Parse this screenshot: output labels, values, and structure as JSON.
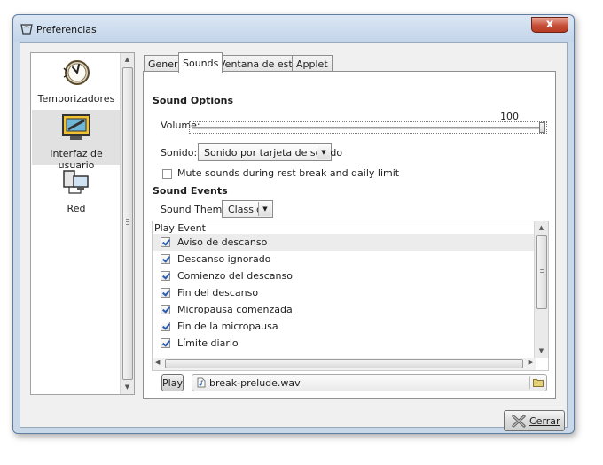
{
  "window": {
    "title": "Preferencias",
    "close_glyph": "x"
  },
  "sidebar": {
    "items": [
      {
        "label": "Temporizadores",
        "icon": "stopwatch-icon"
      },
      {
        "label": "Interfaz de usuario",
        "icon": "monitor-paint-icon"
      },
      {
        "label": "Red",
        "icon": "network-computers-icon"
      }
    ],
    "selected_index": 1
  },
  "tabs": [
    {
      "label": "General"
    },
    {
      "label": "Sounds",
      "active": true
    },
    {
      "label": "Ventana de estado"
    },
    {
      "label": "Applet"
    }
  ],
  "sound_options": {
    "heading": "Sound Options",
    "volume_label": "Volume:",
    "volume_value": "100",
    "volume_level": 100,
    "sonido_label": "Sonido:",
    "sonido_value": "Sonido por tarjeta de sonido",
    "mute_label": "Mute sounds during rest break and daily limit",
    "mute_checked": false
  },
  "sound_events": {
    "heading": "Sound Events",
    "theme_label": "Sound Theme:",
    "theme_value": "Classic",
    "column_header": "Play Event",
    "events": [
      {
        "label": "Aviso de descanso",
        "checked": true
      },
      {
        "label": "Descanso ignorado",
        "checked": true
      },
      {
        "label": "Comienzo del descanso",
        "checked": true
      },
      {
        "label": "Fin del descanso",
        "checked": true
      },
      {
        "label": "Micropausa comenzada",
        "checked": true
      },
      {
        "label": "Fin de la micropausa",
        "checked": true
      },
      {
        "label": "Límite diario",
        "checked": true
      }
    ],
    "play_label": "Play",
    "file_name": "break-prelude.wav"
  },
  "footer": {
    "close_label": "Cerrar"
  }
}
